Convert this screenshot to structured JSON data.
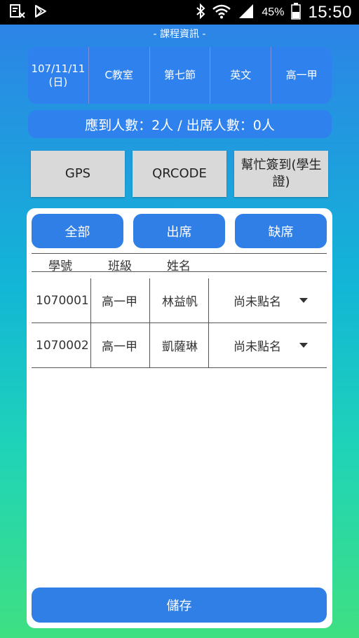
{
  "status_bar": {
    "left_icons": [
      "screenshot-notification-icon",
      "play-store-icon"
    ],
    "right_icons": [
      "bluetooth-icon",
      "wifi-icon",
      "signal-icon",
      "battery-icon"
    ],
    "battery": "45%",
    "time": "15:50"
  },
  "section_title": "- 課程資訊 -",
  "course": {
    "date": "107/11/11",
    "weekday": "(日)",
    "room": "C教室",
    "period": "第七節",
    "subject": "英文",
    "class": "高一甲"
  },
  "attendance_summary": "應到人數：2人 / 出席人數：0人",
  "actions": {
    "gps": "GPS",
    "qrcode": "QRCODE",
    "help_checkin": "幫忙簽到(學生證)"
  },
  "filters": {
    "all": "全部",
    "present": "出席",
    "absent": "缺席"
  },
  "table": {
    "headers": [
      "學號",
      "班級",
      "姓名"
    ],
    "rows": [
      {
        "id": "1070001",
        "class": "高一甲",
        "name": "林益帆",
        "status": "尚未點名"
      },
      {
        "id": "1070002",
        "class": "高一甲",
        "name": "凱薩琳",
        "status": "尚未點名"
      }
    ]
  },
  "save_label": "儲存",
  "colors": {
    "accent": "#2f7fe6",
    "gradient_top": "#2f7fe8",
    "gradient_bottom": "#3fe082"
  }
}
